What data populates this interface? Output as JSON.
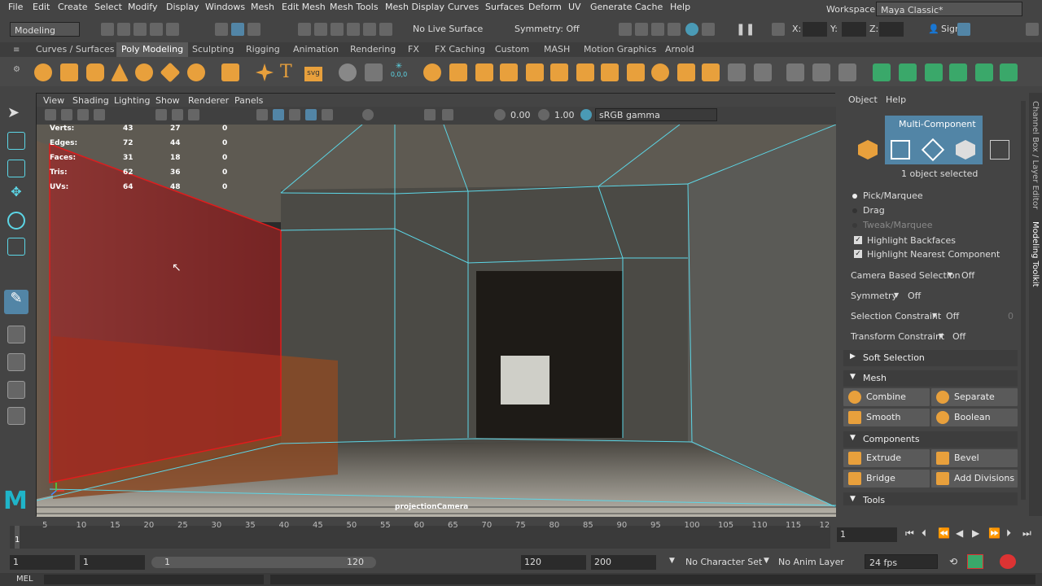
{
  "menus": [
    "File",
    "Edit",
    "Create",
    "Select",
    "Modify",
    "Display",
    "Windows",
    "Mesh",
    "Edit Mesh",
    "Mesh Tools",
    "Mesh Display",
    "Curves",
    "Surfaces",
    "Deform",
    "UV",
    "Generate",
    "Cache",
    "Help"
  ],
  "workspace": {
    "label": "Workspace :",
    "value": "Maya Classic*"
  },
  "status": {
    "mode": "Modeling",
    "live_surface": "No Live Surface",
    "symmetry": "Symmetry: Off",
    "x_label": "X:",
    "y_label": "Y:",
    "z_label": "Z:",
    "sign_in": "Sign"
  },
  "shelf_tabs": [
    "Curves / Surfaces",
    "Poly Modeling",
    "Sculpting",
    "Rigging",
    "Animation",
    "Rendering",
    "FX",
    "FX Caching",
    "Custom",
    "MASH",
    "Motion Graphics",
    "Arnold"
  ],
  "shelf_active": "Poly Modeling",
  "shelf_text_icons": {
    "text_tool": "T",
    "svg_tool": "svg",
    "coord": "0,0,0"
  },
  "viewport": {
    "menus": [
      "View",
      "Shading",
      "Lighting",
      "Show",
      "Renderer",
      "Panels"
    ],
    "exposure": "0.00",
    "gamma": "1.00",
    "color_space": "sRGB gamma",
    "camera": "projectionCamera"
  },
  "hud": [
    {
      "label": "Verts:",
      "a": "43",
      "b": "27",
      "c": "0"
    },
    {
      "label": "Edges:",
      "a": "72",
      "b": "44",
      "c": "0"
    },
    {
      "label": "Faces:",
      "a": "31",
      "b": "18",
      "c": "0"
    },
    {
      "label": "Tris:",
      "a": "62",
      "b": "36",
      "c": "0"
    },
    {
      "label": "UVs:",
      "a": "64",
      "b": "48",
      "c": "0"
    }
  ],
  "panel": {
    "tabs": [
      "Object",
      "Help"
    ],
    "mode_title": "Multi-Component",
    "selected": "1 object selected",
    "pick": "Pick/Marquee",
    "drag": "Drag",
    "tweak": "Tweak/Marquee",
    "highlight_backfaces": "Highlight Backfaces",
    "highlight_nearest": "Highlight Nearest Component",
    "camera_sel": {
      "label": "Camera Based Selection",
      "value": "Off"
    },
    "symmetry": {
      "label": "Symmetry",
      "value": "Off"
    },
    "sel_constraint": {
      "label": "Selection Constraint",
      "value": "Off",
      "num": "0"
    },
    "xform_constraint": {
      "label": "Transform Constraint",
      "value": "Off"
    },
    "soft_selection": "Soft Selection",
    "mesh_section": "Mesh",
    "mesh_buttons": [
      "Combine",
      "Separate",
      "Smooth",
      "Boolean"
    ],
    "components_section": "Components",
    "comp_buttons": [
      "Extrude",
      "Bevel",
      "Bridge",
      "Add Divisions"
    ],
    "tools_section": "Tools"
  },
  "side_tabs": [
    "Channel Box / Layer Editor",
    "Modeling Toolkit"
  ],
  "timeline": {
    "ticks": [
      "5",
      "10",
      "15",
      "20",
      "25",
      "30",
      "35",
      "40",
      "45",
      "50",
      "55",
      "60",
      "65",
      "70",
      "75",
      "80",
      "85",
      "90",
      "95",
      "100",
      "105",
      "110",
      "115",
      "12"
    ],
    "current": "1",
    "current_field": "1"
  },
  "range": {
    "start": "1",
    "anim_start": "1",
    "slider_start": "1",
    "slider_end": "120",
    "end": "120",
    "anim_end": "200",
    "character_set": "No Character Set",
    "anim_layer": "No Anim Layer",
    "fps": "24 fps"
  },
  "cmd": {
    "label": "MEL"
  },
  "colors": {
    "accent": "#5285a6",
    "shelf_orange": "#e8a03c",
    "selection_red": "#c81e1e",
    "wire": "#5cd6e6"
  }
}
